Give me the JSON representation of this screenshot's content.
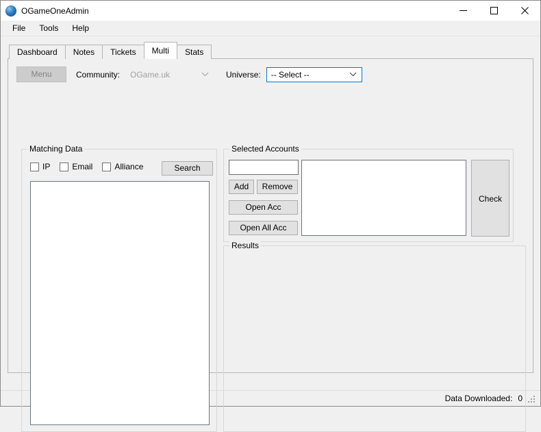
{
  "window": {
    "title": "OGameOneAdmin",
    "icon": "globe-icon",
    "controls": {
      "minimize": "minimize-icon",
      "maximize": "maximize-icon",
      "close": "close-icon"
    }
  },
  "menubar": {
    "items": [
      {
        "label": "File"
      },
      {
        "label": "Tools"
      },
      {
        "label": "Help"
      }
    ]
  },
  "tabs": [
    {
      "label": "Dashboard",
      "active": false
    },
    {
      "label": "Notes",
      "active": false
    },
    {
      "label": "Tickets",
      "active": false
    },
    {
      "label": "Multi",
      "active": true
    },
    {
      "label": "Stats",
      "active": false
    }
  ],
  "toolbar": {
    "menu_button": "Menu",
    "menu_button_enabled": false,
    "community_label": "Community:",
    "community_value": "OGame.uk",
    "community_enabled": false,
    "universe_label": "Universe:",
    "universe_value": "-- Select --",
    "universe_focused": true
  },
  "matching_data": {
    "title": "Matching Data",
    "checkboxes": [
      {
        "label": "IP",
        "checked": false
      },
      {
        "label": "Email",
        "checked": false
      },
      {
        "label": "Alliance",
        "checked": false
      }
    ],
    "search_button": "Search",
    "list_items": []
  },
  "selected_accounts": {
    "title": "Selected Accounts",
    "input_value": "",
    "input_placeholder": "",
    "add_button": "Add",
    "remove_button": "Remove",
    "open_acc_button": "Open Acc",
    "open_all_acc_button": "Open All Acc",
    "check_button": "Check",
    "list_items": []
  },
  "results": {
    "title": "Results",
    "content": ""
  },
  "statusbar": {
    "label": "Data Downloaded:",
    "value": "0",
    "grip": "resize-grip-icon"
  },
  "colors": {
    "accent_focus": "#0078d7",
    "window_bg": "#f0f0f0",
    "button_face": "#e1e1e1",
    "disabled_face": "#cccccc",
    "disabled_text": "#838383",
    "group_border": "#d6d6d6"
  }
}
